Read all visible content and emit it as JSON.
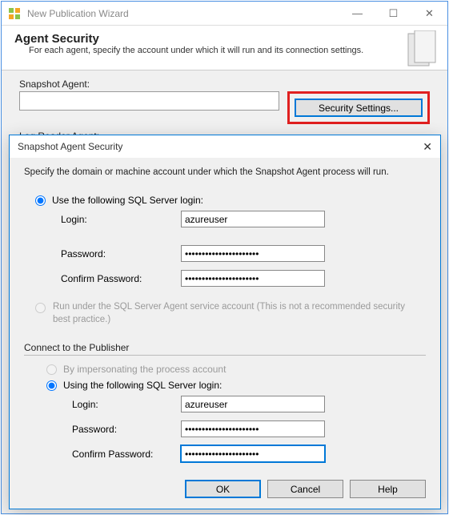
{
  "window": {
    "title": "New Publication Wizard",
    "minimize": "—",
    "maximize": "☐",
    "close": "✕"
  },
  "header": {
    "title": "Agent Security",
    "subtitle": "For each agent, specify the account under which it will run and its connection settings."
  },
  "snapshot_agent": {
    "label": "Snapshot Agent:",
    "value": "",
    "button": "Security Settings..."
  },
  "log_reader_agent": {
    "label": "Log Reader Agent:"
  },
  "modal": {
    "title": "Snapshot Agent Security",
    "close": "✕",
    "instruction": "Specify the domain or machine account under which the Snapshot Agent process will run.",
    "opt_sql_login": "Use the following SQL Server login:",
    "login_label": "Login:",
    "login_value": "azureuser",
    "password_label": "Password:",
    "password_value": "••••••••••••••••••••••",
    "confirm_label": "Confirm Password:",
    "confirm_value": "••••••••••••••••••••••",
    "opt_service_account": "Run under the SQL Server Agent service account (This is not a recommended security best practice.)",
    "connect_group": "Connect to the Publisher",
    "opt_impersonate": "By impersonating the process account",
    "opt_pub_sql_login": "Using the following SQL Server login:",
    "pub_login_label": "Login:",
    "pub_login_value": "azureuser",
    "pub_password_label": "Password:",
    "pub_password_value": "••••••••••••••••••••••",
    "pub_confirm_label": "Confirm Password:",
    "pub_confirm_value": "••••••••••••••••••••••",
    "ok": "OK",
    "cancel": "Cancel",
    "help": "Help"
  }
}
